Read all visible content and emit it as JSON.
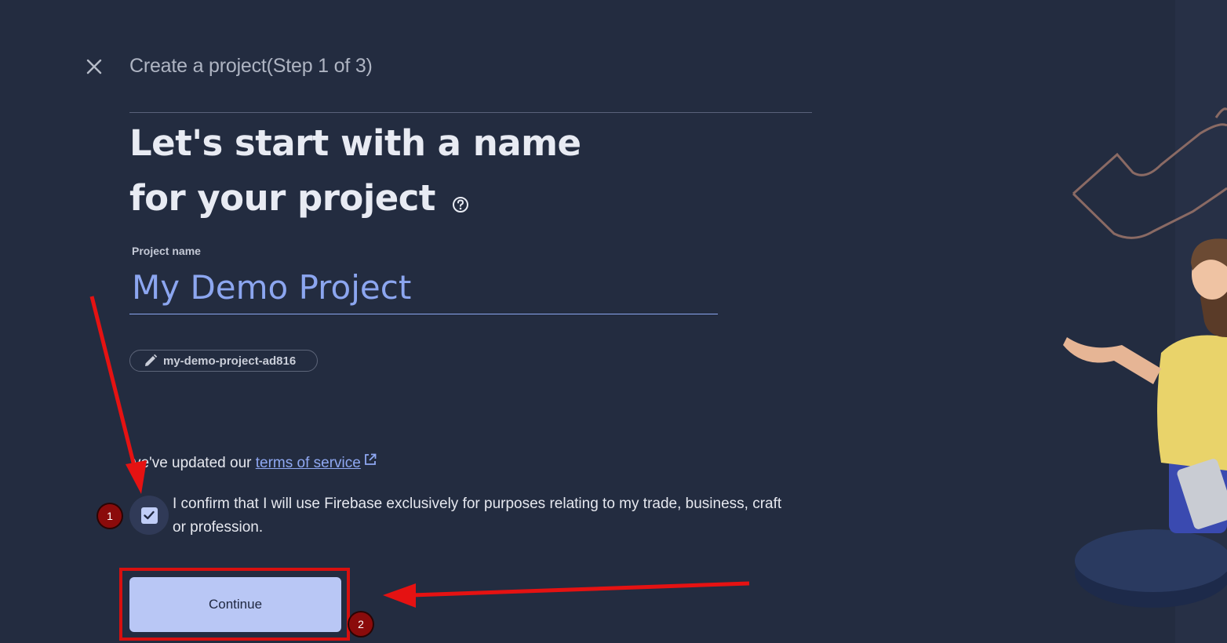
{
  "header": {
    "close_icon": "close-icon",
    "title": "Create a project(Step 1 of 3)"
  },
  "main": {
    "headline": "Let's start with a name for your project",
    "help_icon": "help-circle-icon",
    "field_label": "Project name",
    "project_name_value": "My Demo Project",
    "project_id": "my-demo-project-ad816",
    "project_id_icon": "pencil-icon",
    "terms_prefix": "ve've updated our",
    "terms_link": "terms of service",
    "terms_icon": "external-link-icon",
    "confirm_text": "I confirm that I will use Firebase exclusively for purposes relating to my trade, business, craft or profession.",
    "confirm_checked": true,
    "continue_label": "Continue"
  },
  "annotations": {
    "marker_1": "1",
    "marker_2": "2",
    "annotation_color": "#d8100f"
  },
  "colors": {
    "background": "#232c40",
    "accent": "#8ca6f0",
    "button": "#b9c7f5"
  }
}
